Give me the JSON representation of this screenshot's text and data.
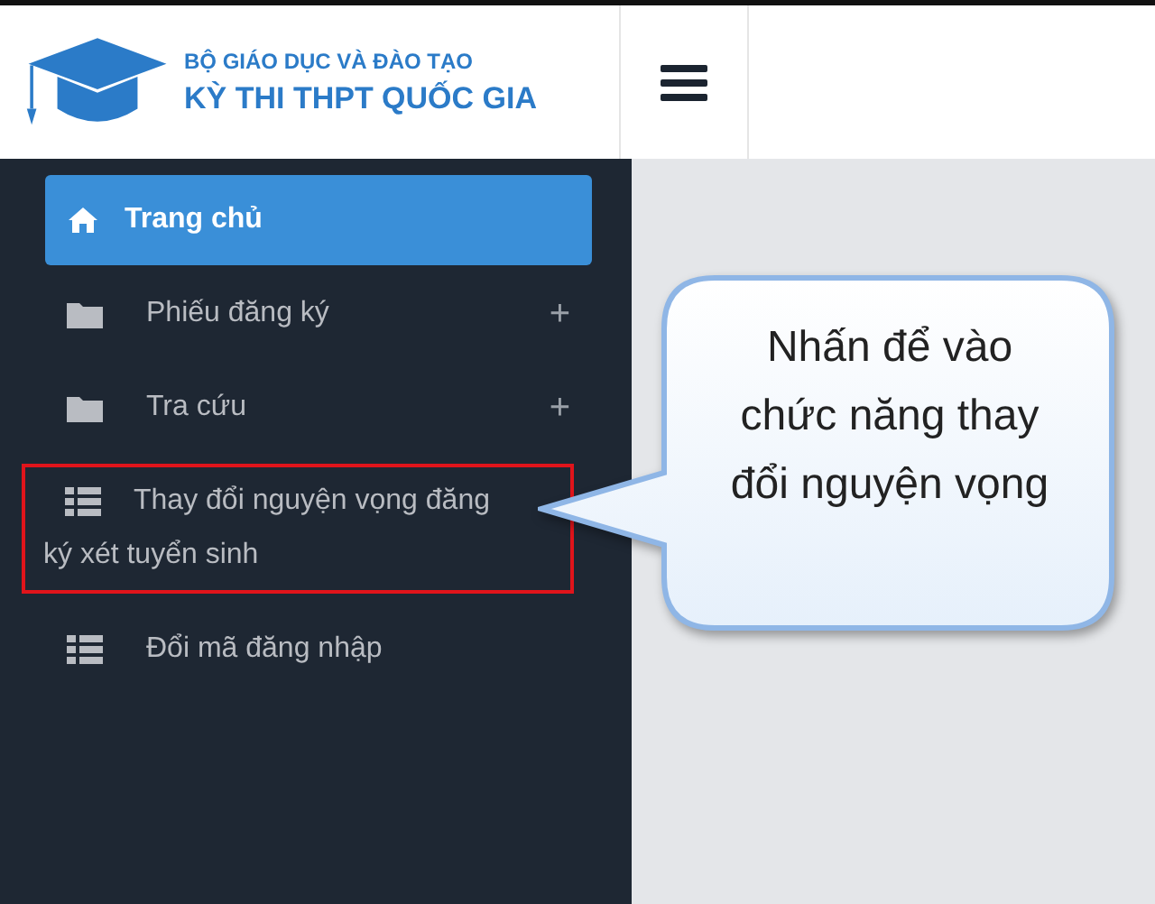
{
  "header": {
    "org": "BỘ GIÁO DỤC VÀ ĐÀO TẠO",
    "title": "KỲ THI THPT QUỐC GIA"
  },
  "sidebar": {
    "items": [
      {
        "kind": "home",
        "label": "Trang chủ",
        "selected": true,
        "highlighted": false
      },
      {
        "kind": "folder",
        "label": "Phiếu đăng ký",
        "selected": false,
        "expander": "+",
        "highlighted": false
      },
      {
        "kind": "folder",
        "label": "Tra cứu",
        "selected": false,
        "expander": "+",
        "highlighted": false
      },
      {
        "kind": "list",
        "label": "Thay đổi nguyện vọng đăng ký xét tuyển sinh",
        "selected": false,
        "highlighted": true
      },
      {
        "kind": "list",
        "label": "Đổi mã đăng nhập",
        "selected": false,
        "highlighted": false
      }
    ]
  },
  "callout": {
    "text": "Nhấn để vào chức năng thay đổi nguyện vọng"
  }
}
